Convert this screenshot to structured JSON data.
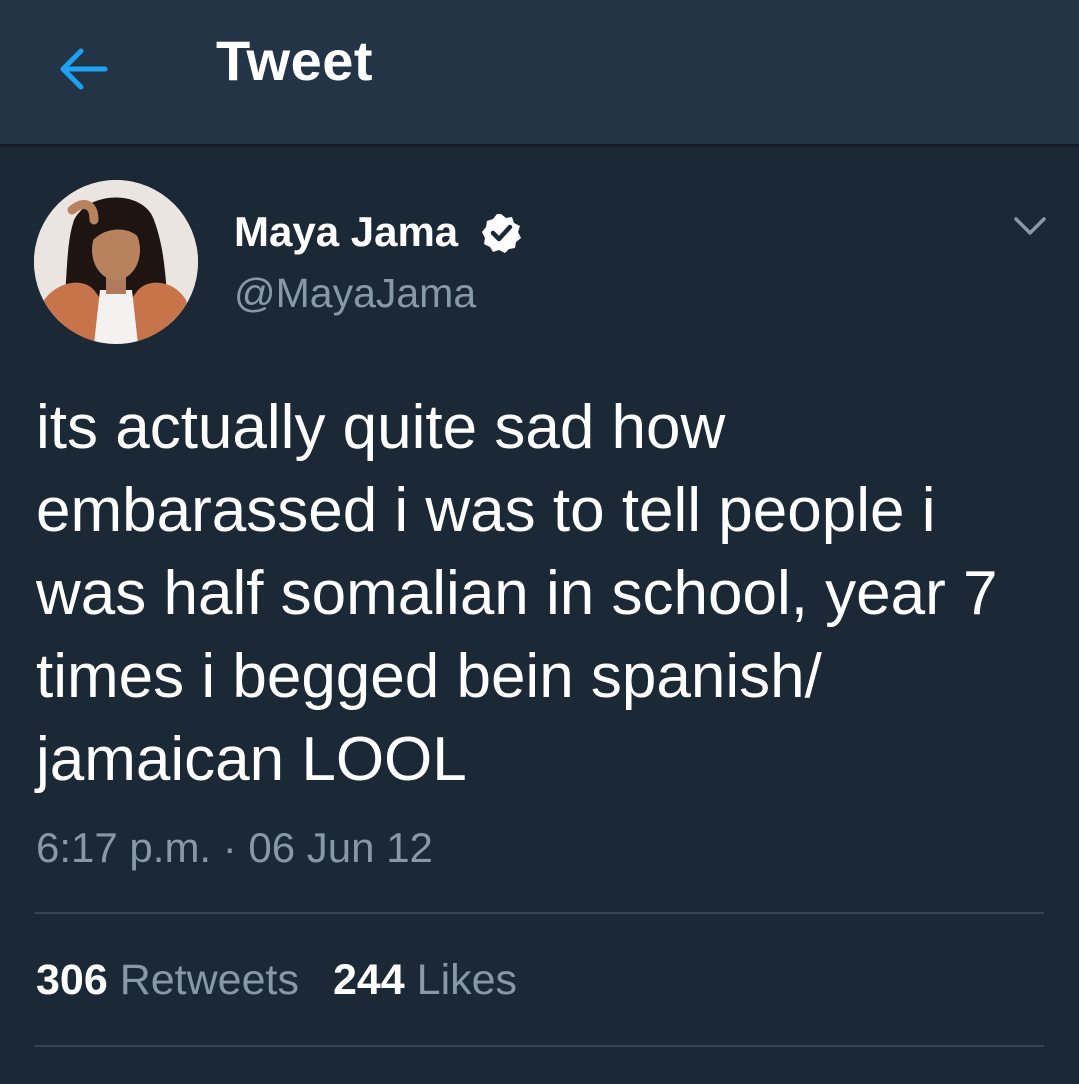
{
  "header": {
    "title": "Tweet",
    "back_icon": "arrow-left-icon",
    "accent_color": "#1da1f2"
  },
  "tweet": {
    "author": {
      "name": "Maya Jama",
      "handle": "@MayaJama",
      "verified": true
    },
    "text": "its actually quite sad how embarassed i was to tell people i was half somalian in school, year 7 times i begged bein spanish/ jamaican LOOL",
    "timestamp": "6:17 p.m. · 06 Jun 12",
    "stats": {
      "retweets_count": "306",
      "retweets_label": "Retweets",
      "likes_count": "244",
      "likes_label": "Likes"
    }
  },
  "colors": {
    "background": "#1b2836",
    "header_background": "#243447",
    "secondary_text": "#8899a6",
    "divider": "#38444d"
  }
}
